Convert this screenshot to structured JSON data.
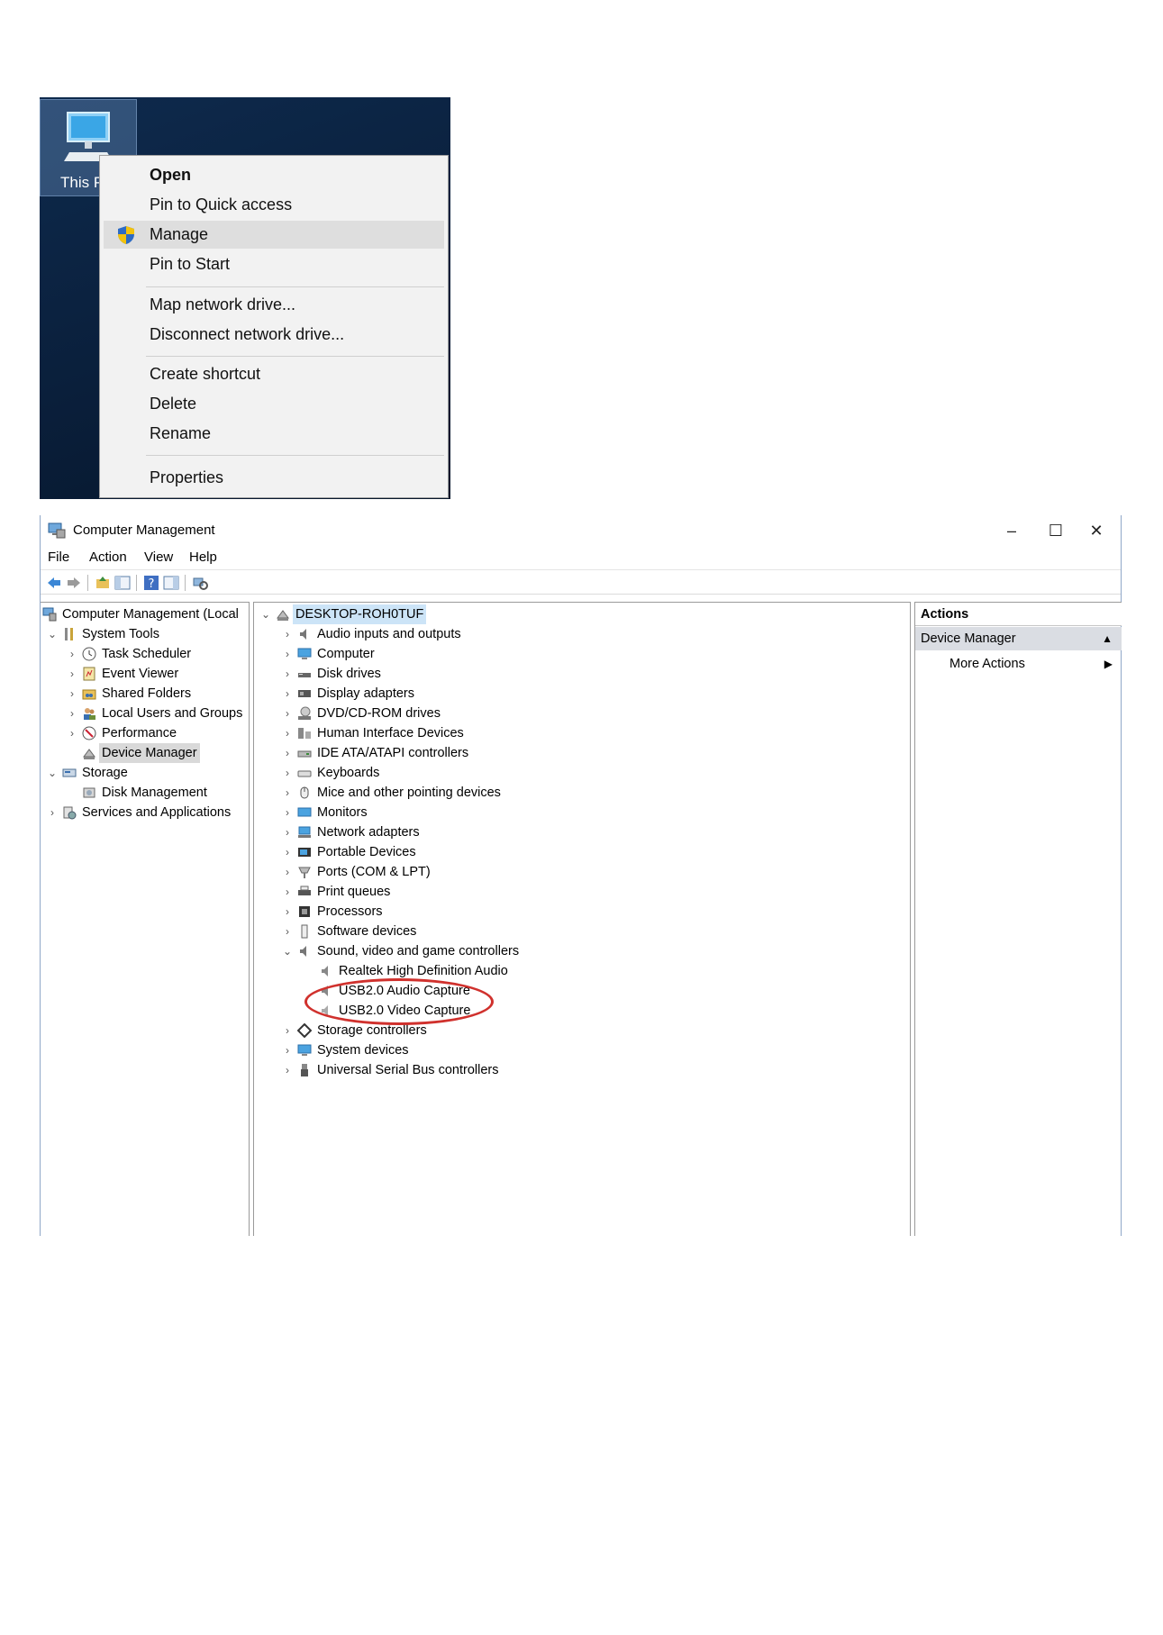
{
  "desktop": {
    "icon_label": "This P",
    "context_menu": {
      "items": [
        "Open",
        "Pin to Quick access",
        "Manage",
        "Pin to Start",
        "Map network drive...",
        "Disconnect network drive...",
        "Create shortcut",
        "Delete",
        "Rename",
        "Properties"
      ]
    }
  },
  "window": {
    "title": "Computer Management",
    "controls": {
      "minimize": "–",
      "maximize": "☐",
      "close": "✕"
    },
    "menu": [
      "File",
      "Action",
      "View",
      "Help"
    ]
  },
  "left_tree": [
    "Computer Management (Local",
    "System Tools",
    "Task Scheduler",
    "Event Viewer",
    "Shared Folders",
    "Local Users and Groups",
    "Performance",
    "Device Manager",
    "Storage",
    "Disk Management",
    "Services and Applications"
  ],
  "device_tree": {
    "root": "DESKTOP-ROH0TUF",
    "categories": [
      "Audio inputs and outputs",
      "Computer",
      "Disk drives",
      "Display adapters",
      "DVD/CD-ROM drives",
      "Human Interface Devices",
      "IDE ATA/ATAPI controllers",
      "Keyboards",
      "Mice and other pointing devices",
      "Monitors",
      "Network adapters",
      "Portable Devices",
      "Ports (COM & LPT)",
      "Print queues",
      "Processors",
      "Software devices",
      "Sound, video and game controllers",
      "Realtek High Definition Audio",
      "USB2.0 Audio Capture",
      "USB2.0 Video Capture",
      "Storage controllers",
      "System devices",
      "Universal Serial Bus controllers"
    ]
  },
  "actions": {
    "header": "Actions",
    "section": "Device Manager",
    "item": "More Actions"
  },
  "colors": {
    "selection": "#cce4f7",
    "annotation": "#d0312d",
    "desktop": "#0e2a4d"
  }
}
